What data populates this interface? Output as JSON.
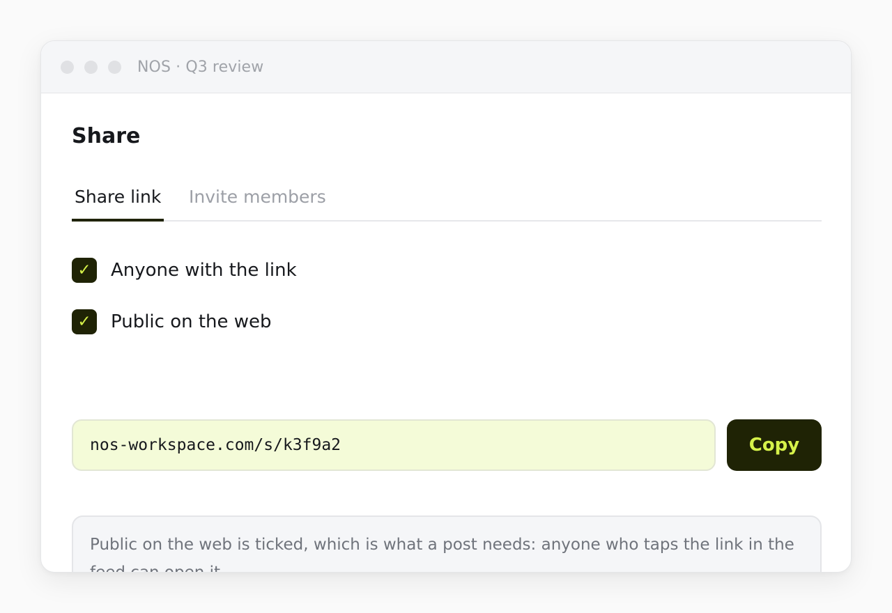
{
  "window": {
    "title": "NOS · Q3 review"
  },
  "dialog": {
    "heading": "Share",
    "tabs": [
      {
        "label": "Share link",
        "active": true
      },
      {
        "label": "Invite members",
        "active": false
      }
    ],
    "options": [
      {
        "label": "Anyone with the link",
        "checked": true
      },
      {
        "label": "Public on the web",
        "checked": true
      }
    ],
    "link_url": "nos-workspace.com/s/k3f9a2",
    "copy_label": "Copy",
    "checkmark_glyph": "✓",
    "note": "Public on the web is ticked, which is what a post needs: anyone who taps the link in the feed can open it."
  },
  "colors": {
    "accent_dark": "#1f2305",
    "accent_lime": "#d6f24a",
    "field_background": "#f4fbd8"
  }
}
